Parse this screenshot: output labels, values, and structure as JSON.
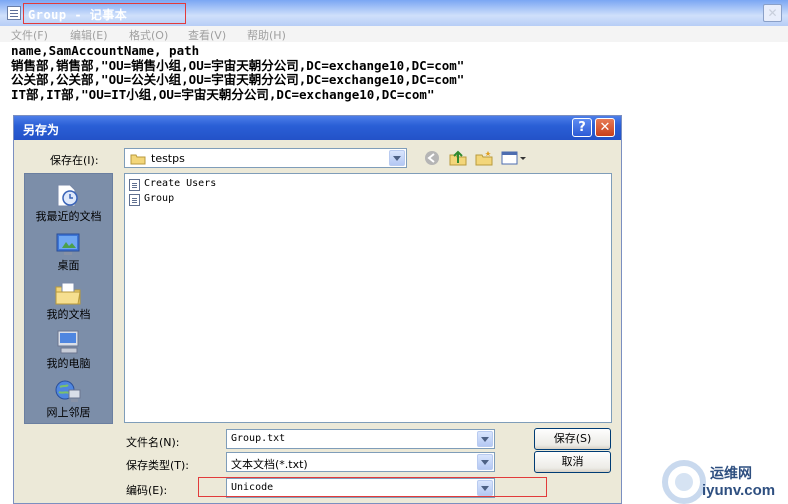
{
  "notepad": {
    "title": "Group - 记事本",
    "close_glyph": "✕",
    "menu": [
      "文件(F)",
      "编辑(E)",
      "格式(O)",
      "查看(V)",
      "帮助(H)"
    ],
    "lines": [
      "name,SamAccountName, path",
      "销售部,销售部,\"OU=销售小组,OU=宇宙天朝分公司,DC=exchange10,DC=com\"",
      "公关部,公关部,\"OU=公关小组,OU=宇宙天朝分公司,DC=exchange10,DC=com\"",
      "IT部,IT部,\"OU=IT小组,OU=宇宙天朝分公司,DC=exchange10,DC=com\""
    ]
  },
  "dialog": {
    "title": "另存为",
    "help_glyph": "?",
    "close_glyph": "✕",
    "save_in_label": "保存在(I):",
    "save_in_value": "testps",
    "places": [
      {
        "label": "我最近的文档",
        "icon": "recent-documents-icon"
      },
      {
        "label": "桌面",
        "icon": "desktop-icon"
      },
      {
        "label": "我的文档",
        "icon": "my-documents-icon"
      },
      {
        "label": "我的电脑",
        "icon": "my-computer-icon"
      },
      {
        "label": "网上邻居",
        "icon": "network-places-icon"
      }
    ],
    "files": [
      "Create Users",
      "Group"
    ],
    "filename_label": "文件名(N):",
    "filename_value": "Group.txt",
    "filetype_label": "保存类型(T):",
    "filetype_value": "文本文档(*.txt)",
    "encoding_label": "编码(E):",
    "encoding_value": "Unicode",
    "save_button": "保存(S)",
    "cancel_button": "取消"
  },
  "watermark": {
    "brand": "运维网",
    "url": "iyunv.com"
  },
  "colors": {
    "annotation_red": "#e23b3b",
    "xp_blue": "#2352c8"
  }
}
